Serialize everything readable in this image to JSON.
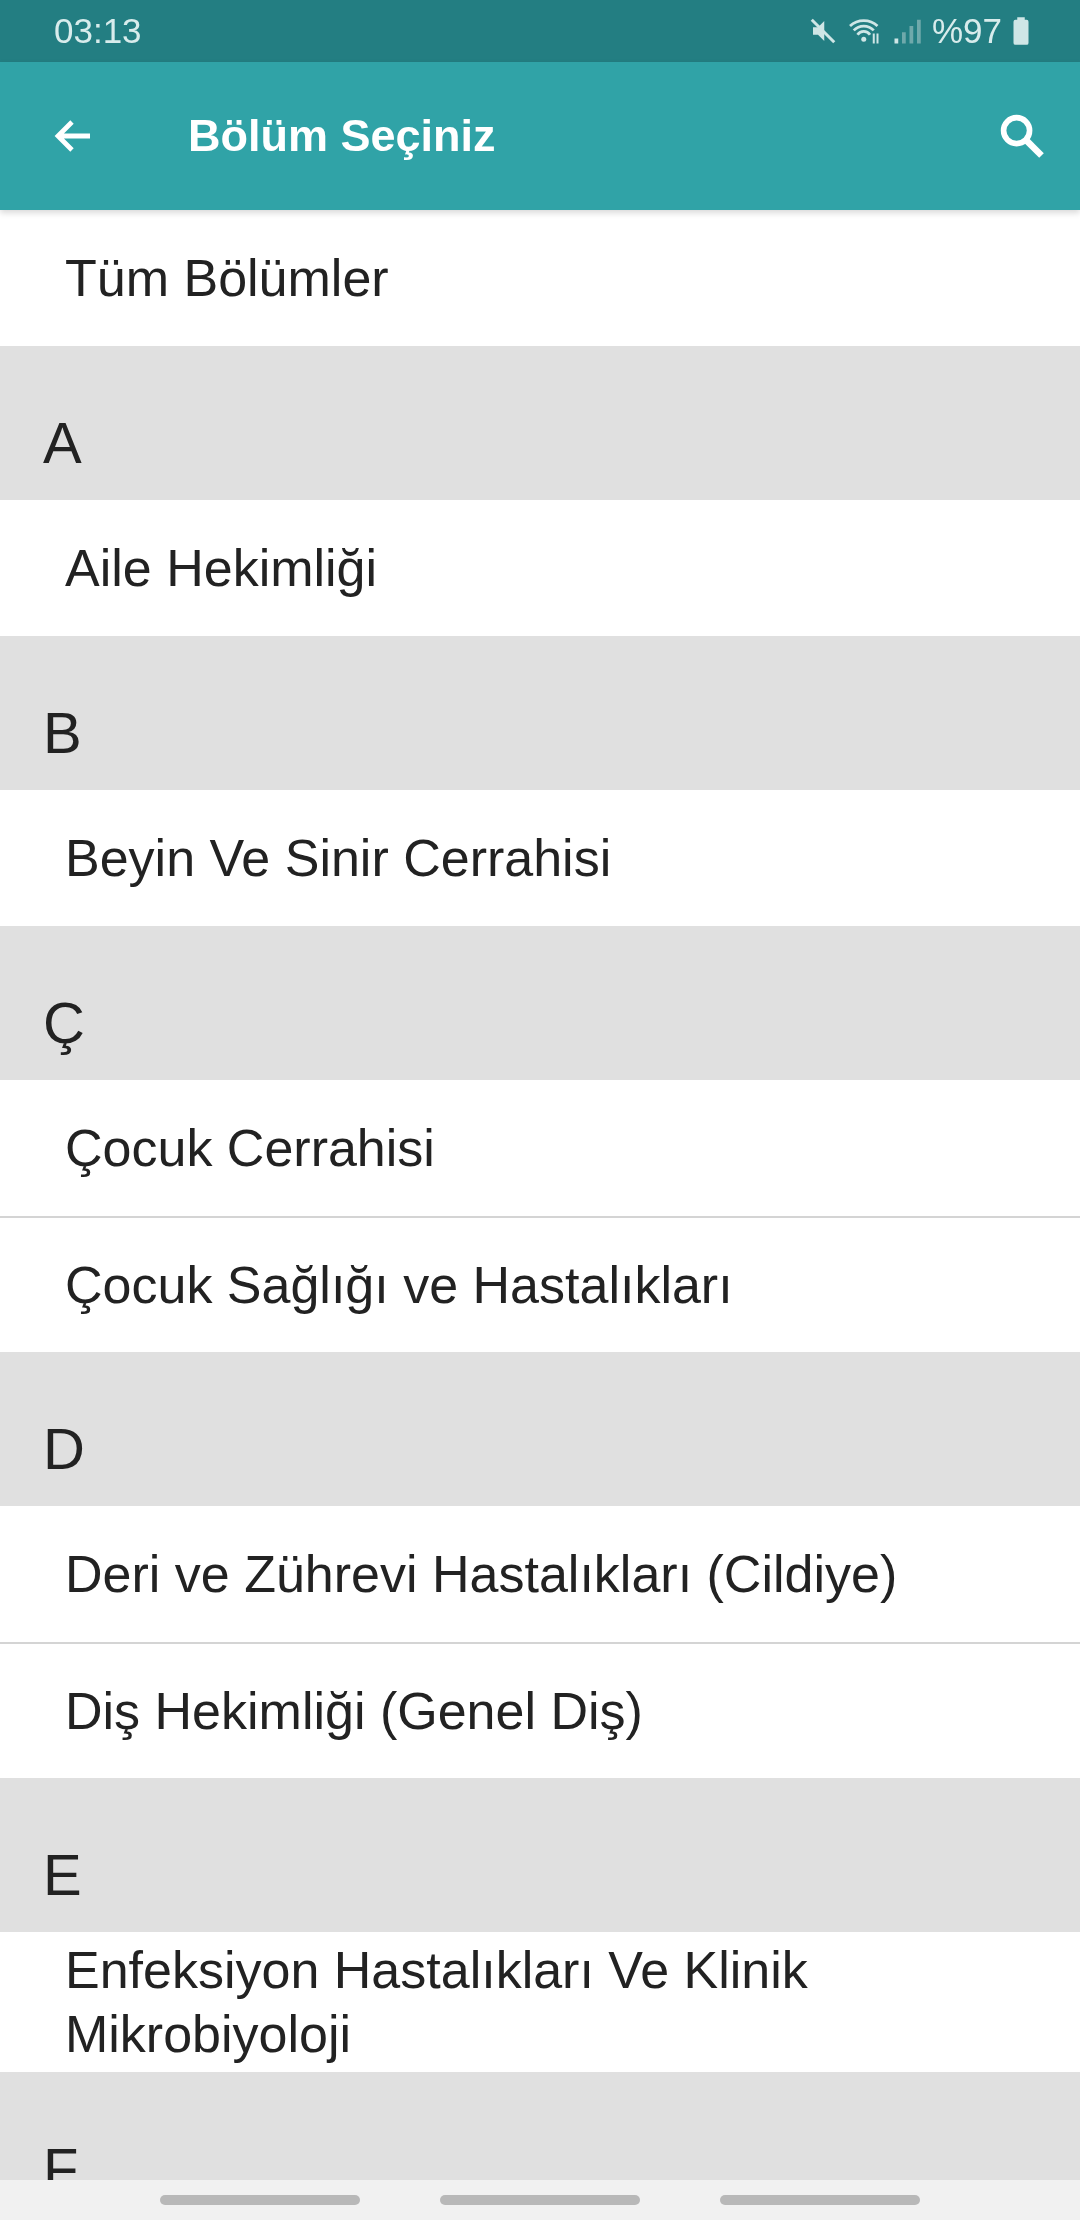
{
  "status_bar": {
    "time": "03:13",
    "battery": "%97"
  },
  "app_bar": {
    "title": "Bölüm Seçiniz"
  },
  "top_items": [
    {
      "label": "Tüm Bölümler"
    }
  ],
  "sections": [
    {
      "letter": "A",
      "items": [
        {
          "label": "Aile Hekimliği"
        }
      ]
    },
    {
      "letter": "B",
      "items": [
        {
          "label": "Beyin Ve Sinir Cerrahisi"
        }
      ]
    },
    {
      "letter": "Ç",
      "items": [
        {
          "label": "Çocuk Cerrahisi"
        },
        {
          "label": "Çocuk Sağlığı ve Hastalıkları"
        }
      ]
    },
    {
      "letter": "D",
      "items": [
        {
          "label": "Deri ve Zührevi Hastalıkları (Cildiye)"
        },
        {
          "label": "Diş Hekimliği (Genel Diş)"
        }
      ]
    },
    {
      "letter": "E",
      "items": [
        {
          "label": "Enfeksiyon Hastalıkları Ve Klinik Mikrobiyoloji"
        }
      ]
    },
    {
      "letter": "F"
    }
  ]
}
